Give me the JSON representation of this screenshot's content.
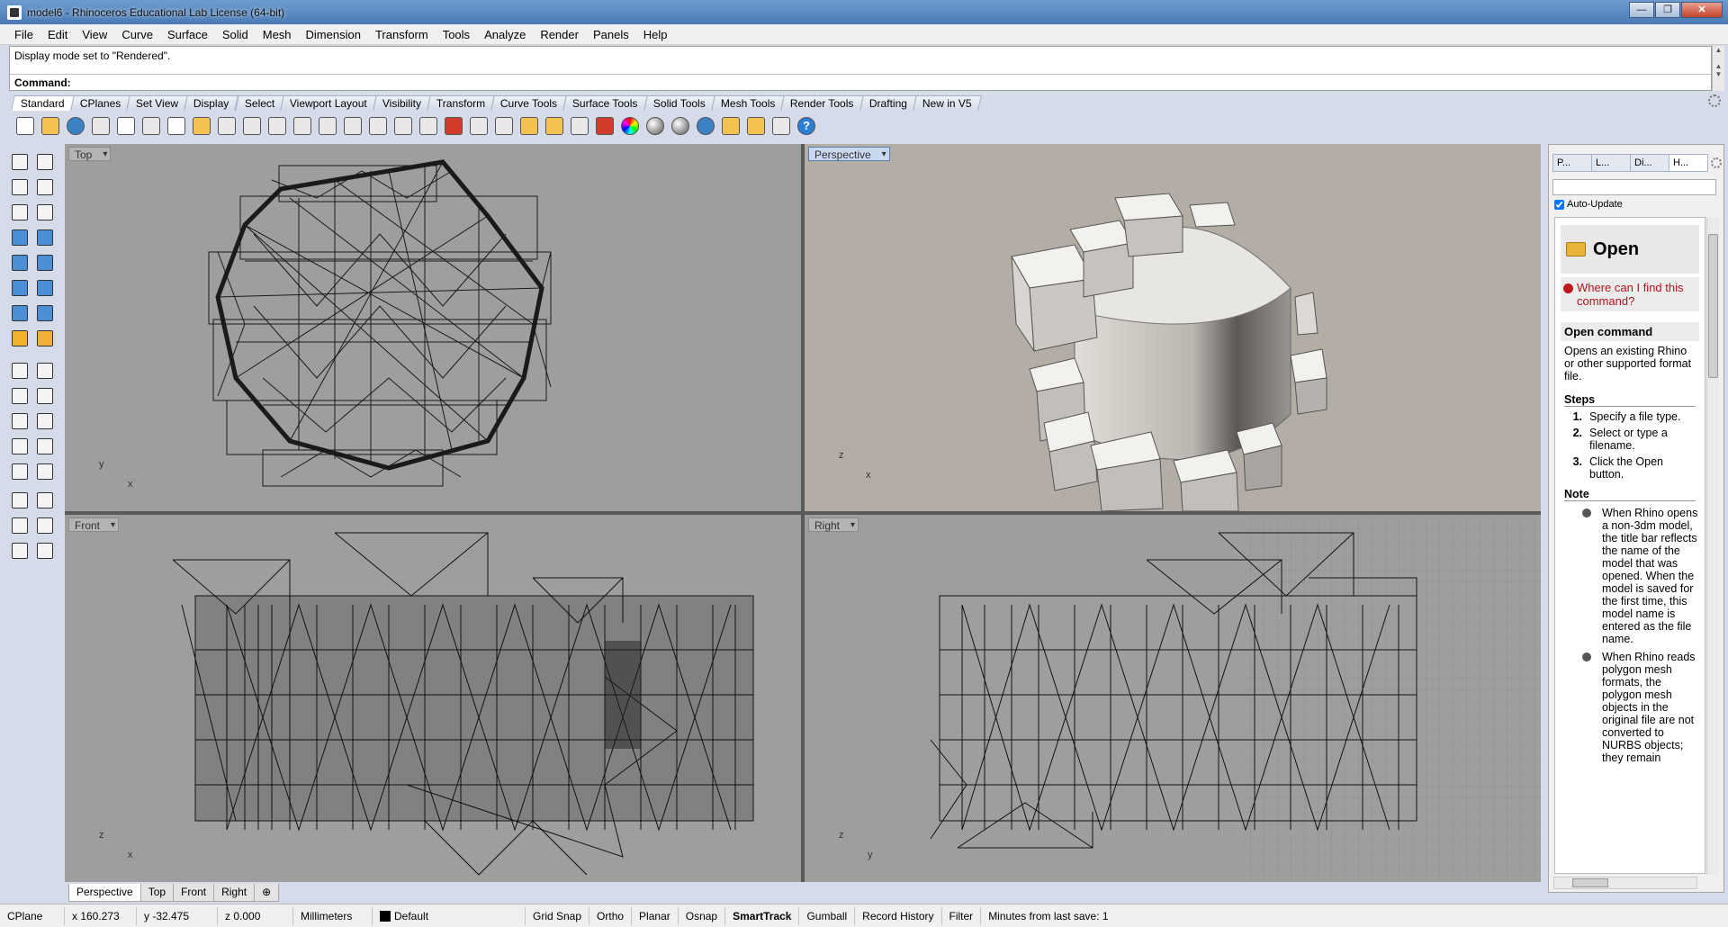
{
  "window": {
    "title": "model6 - Rhinoceros Educational Lab License (64-bit)",
    "controls": [
      "—",
      "❐",
      "✕"
    ]
  },
  "menu": [
    "File",
    "Edit",
    "View",
    "Curve",
    "Surface",
    "Solid",
    "Mesh",
    "Dimension",
    "Transform",
    "Tools",
    "Analyze",
    "Render",
    "Panels",
    "Help"
  ],
  "command": {
    "history": "Display mode set to \"Rendered\".",
    "prompt_label": "Command:",
    "value": ""
  },
  "toolbar_tabs": [
    "Standard",
    "CPlanes",
    "Set View",
    "Display",
    "Select",
    "Viewport Layout",
    "Visibility",
    "Transform",
    "Curve Tools",
    "Surface Tools",
    "Solid Tools",
    "Mesh Tools",
    "Render Tools",
    "Drafting",
    "New in V5"
  ],
  "toolbar_icons": [
    "new-file-icon",
    "open-file-icon",
    "save-icon",
    "print-icon",
    "copy-file-icon",
    "cut-icon",
    "copy-icon",
    "paste-icon",
    "undo-icon",
    "pan-hand-icon",
    "move-view-icon",
    "zoom-icon",
    "zoom-window-icon",
    "zoom-extents-icon",
    "zoom-selected-icon",
    "rotate-view-icon",
    "grid-icon",
    "car-icon",
    "shade-icon",
    "snap-icon",
    "lights-icon",
    "bulb-icon",
    "lock-icon",
    "layer-icon",
    "color-wheel-icon",
    "material-ball-icon",
    "environment-icon",
    "render-icon",
    "filter-icon",
    "settings-gear-icon",
    "dimension-icon",
    "help-icon"
  ],
  "viewports": [
    {
      "id": "top",
      "label": "Top",
      "axes": [
        "y",
        "x"
      ]
    },
    {
      "id": "perspective",
      "label": "Perspective",
      "axes": [
        "z",
        "x"
      ]
    },
    {
      "id": "front",
      "label": "Front",
      "axes": [
        "z",
        "x"
      ]
    },
    {
      "id": "right",
      "label": "Right",
      "axes": [
        "z",
        "y"
      ]
    }
  ],
  "viewport_tabs": [
    "Perspective",
    "Top",
    "Front",
    "Right",
    "⊕"
  ],
  "panel": {
    "tabs": [
      "P...",
      "L...",
      "Di...",
      "H..."
    ],
    "auto_update": "Auto-Update",
    "help": {
      "title": "Open",
      "where": "Where can I find this command?",
      "heading": "Open command",
      "description": "Opens an existing Rhino or other supported format file.",
      "steps_title": "Steps",
      "steps": [
        {
          "n": "1.",
          "text": "Specify a file type."
        },
        {
          "n": "2.",
          "text": "Select or type a filename."
        },
        {
          "n": "3.",
          "text": "Click the Open button."
        }
      ],
      "note_title": "Note",
      "notes": [
        "When Rhino opens a non-3dm model, the title bar reflects the name of the model that was opened. When the model is saved for the first time, this model name is entered as the file name.",
        "When Rhino reads polygon mesh formats, the polygon mesh objects in the original file are not converted to NURBS objects; they remain"
      ]
    }
  },
  "status": {
    "cplane": "CPlane",
    "x": "x 160.273",
    "y": "y -32.475",
    "z": "z 0.000",
    "units": "Millimeters",
    "layer": "Default",
    "toggles": [
      "Grid Snap",
      "Ortho",
      "Planar",
      "Osnap",
      "SmartTrack",
      "Gumball",
      "Record History",
      "Filter"
    ],
    "active_toggle": "SmartTrack",
    "save_info": "Minutes from last save: 1"
  },
  "colors": {
    "viewport_bg": "#9e9e9e",
    "perspective_bg": "#b3ada5",
    "titlebar": "#4a7ab5",
    "help_red": "#b0141c"
  }
}
